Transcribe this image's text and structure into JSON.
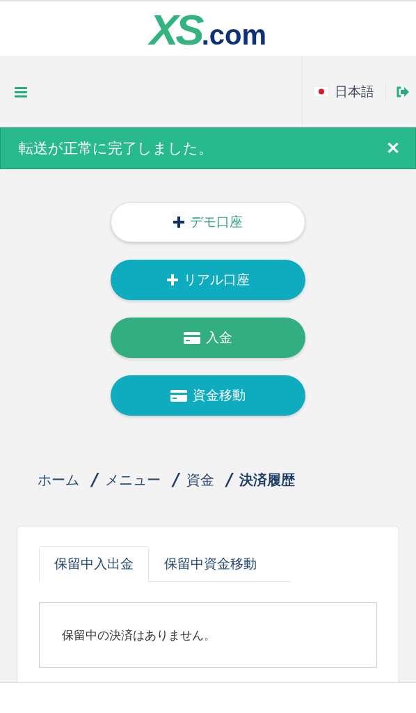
{
  "logo": {
    "mark": "XS",
    "suffix": ".com"
  },
  "header": {
    "language": {
      "label": "日本語"
    }
  },
  "alert": {
    "message": "転送が正常に完了しました。",
    "close": "✕"
  },
  "actions": [
    {
      "label": "デモ口座",
      "kind": "demo"
    },
    {
      "label": "リアル口座",
      "kind": "real"
    },
    {
      "label": "入金",
      "kind": "deposit"
    },
    {
      "label": "資金移動",
      "kind": "transfer"
    }
  ],
  "breadcrumb": [
    {
      "label": "ホーム",
      "current": false
    },
    {
      "separator": "/",
      "label": "メニュー",
      "current": false
    },
    {
      "separator": "/",
      "label": "資金",
      "current": false
    },
    {
      "separator": "/",
      "label": "決済履歴",
      "current": true
    }
  ],
  "tabs": [
    {
      "label": "保留中入出金",
      "selected": true
    },
    {
      "label": "保留中資金移動",
      "selected": false
    }
  ],
  "empty_message": "保留中の決済はありません。"
}
